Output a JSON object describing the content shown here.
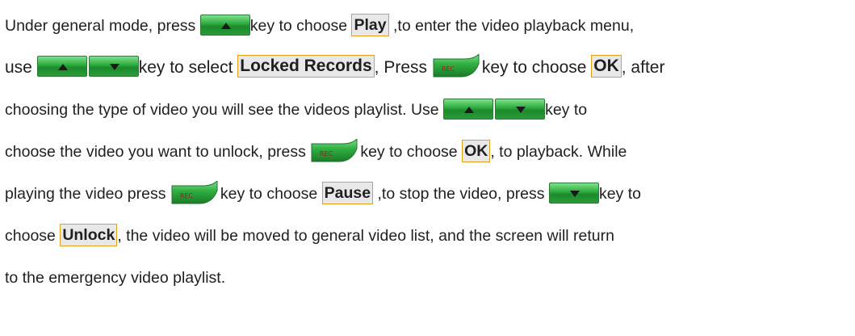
{
  "document": {
    "line1": {
      "a": "Under general mode, press ",
      "b": "key to choose ",
      "c": "Play",
      "d": " ,to enter the video playback menu,"
    },
    "line2": {
      "a": "use ",
      "b": "key to select ",
      "c": "Locked Records",
      "d": ", Press ",
      "e": "key to choose ",
      "f": "OK",
      "g": ", after"
    },
    "line3": {
      "a": "choosing the type of video you will see the videos playlist. Use ",
      "b": "key to"
    },
    "line4": {
      "a": "choose the video you want to unlock, press ",
      "b": "key to choose ",
      "c": "OK",
      "d": ", to playback. While"
    },
    "line5": {
      "a": "playing the video press ",
      "b": "key to choose ",
      "c": "Pause",
      "d": " ,to stop the video, press ",
      "e": "key to"
    },
    "line6": {
      "a": "choose ",
      "b": "Unlock",
      "c": ", the video will be moved to general video list, and the screen will return"
    },
    "line7": {
      "a": "to the emergency video playlist."
    }
  },
  "icons": {
    "up_key": "up-arrow-key-icon",
    "down_key": "down-arrow-key-icon",
    "rec_key": "rec-key-icon"
  },
  "rec_label": "REC",
  "colors": {
    "key_green": "#2fae3f",
    "highlight_border": "#e0a020",
    "highlight_fill": "#e8e8e8"
  }
}
